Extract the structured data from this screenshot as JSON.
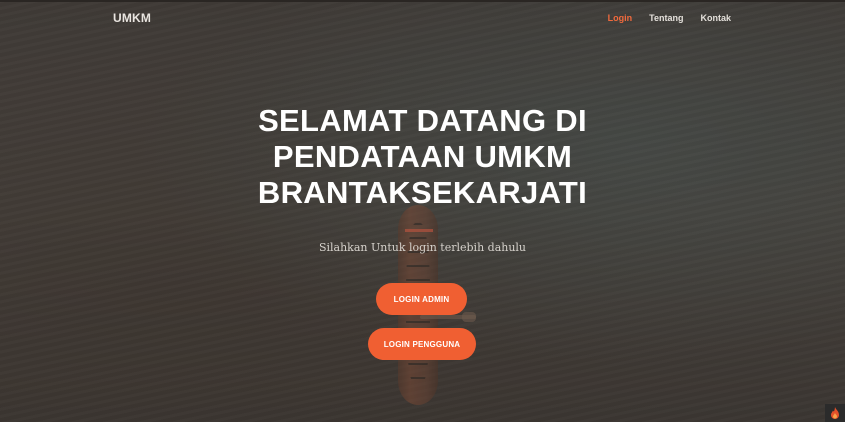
{
  "navbar": {
    "brand": "UMKM",
    "links": [
      {
        "label": "Login",
        "active": true
      },
      {
        "label": "Tentang",
        "active": false
      },
      {
        "label": "Kontak",
        "active": false
      }
    ]
  },
  "hero": {
    "title_lines": [
      "SELAMAT DATANG DI",
      "PENDATAAN UMKM",
      "BRANTAKSEKARJATI"
    ],
    "subtitle": "Silahkan Untuk login terlebih dahulu",
    "buttons": {
      "admin_label": "LOGIN ADMIN",
      "user_label": "LOGIN PENGGUNA"
    }
  },
  "colors": {
    "accent": "#f05f32",
    "active_link": "#f16a3d",
    "background": "#403b37"
  },
  "icons": {
    "corner_badge": "flame-icon"
  }
}
